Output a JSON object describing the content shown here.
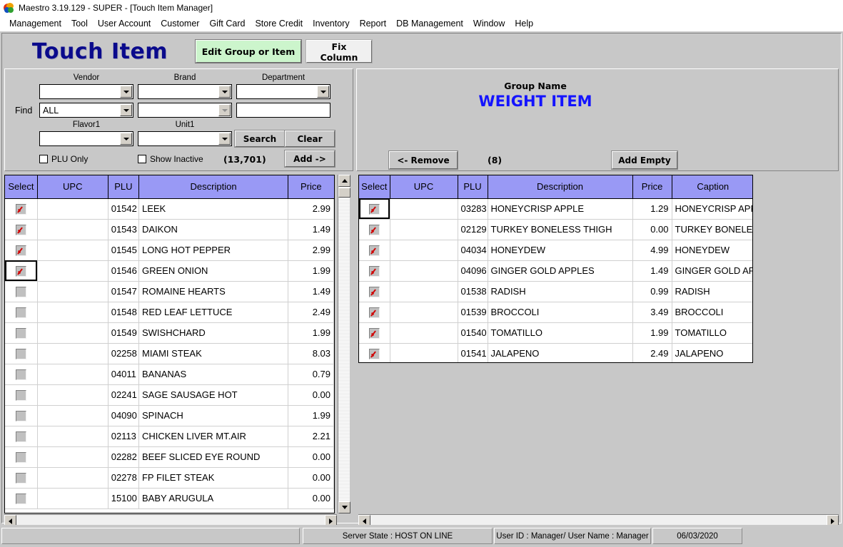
{
  "window": {
    "title": "Maestro  3.19.129 - SUPER - [Touch Item Manager]",
    "icon": "maestro-app-icon"
  },
  "menubar": {
    "items": [
      {
        "label": "Management"
      },
      {
        "label": "Tool"
      },
      {
        "label": "User Account"
      },
      {
        "label": "Customer"
      },
      {
        "label": "Gift Card"
      },
      {
        "label": "Store Credit"
      },
      {
        "label": "Inventory"
      },
      {
        "label": "Report"
      },
      {
        "label": "DB Management"
      },
      {
        "label": "Window"
      },
      {
        "label": "Help"
      }
    ]
  },
  "header": {
    "title": "Touch Item",
    "edit_group_button": "Edit Group or Item",
    "fix_column_button": "Fix Column",
    "title_color": "#0a0a8c",
    "edit_group_bg": "#ccf5cc"
  },
  "search": {
    "find_label": "Find",
    "vendor_label": "Vendor",
    "brand_label": "Brand",
    "department_label": "Department",
    "flavor_label": "Flavor1",
    "unit_label": "Unit1",
    "vendor_value": "",
    "brand_value": "",
    "department_value": "",
    "find_vendor_value": "ALL",
    "find_brand_value": "",
    "find_department_value": "",
    "flavor_value": "",
    "unit_value": "",
    "search_button": "Search",
    "clear_button": "Clear",
    "add_button": "Add ->",
    "plu_only_label": "PLU Only",
    "show_inactive_label": "Show Inactive",
    "plu_only_checked": false,
    "show_inactive_checked": false,
    "result_count": "(13,701)"
  },
  "group": {
    "name_label": "Group Name",
    "name_value": "WEIGHT ITEM",
    "name_color": "#1414ff",
    "remove_button": "<- Remove",
    "add_empty_button": "Add Empty",
    "item_count": "(8)"
  },
  "left_grid": {
    "columns": [
      "Select",
      "UPC",
      "PLU",
      "Description",
      "Price"
    ],
    "focused_row": 3,
    "rows": [
      {
        "checked": true,
        "upc": "",
        "plu": "01542",
        "description": "LEEK",
        "price": "2.99"
      },
      {
        "checked": true,
        "upc": "",
        "plu": "01543",
        "description": "DAIKON",
        "price": "1.49"
      },
      {
        "checked": true,
        "upc": "",
        "plu": "01545",
        "description": "LONG HOT PEPPER",
        "price": "2.99"
      },
      {
        "checked": true,
        "upc": "",
        "plu": "01546",
        "description": "GREEN ONION",
        "price": "1.99"
      },
      {
        "checked": false,
        "upc": "",
        "plu": "01547",
        "description": "ROMAINE HEARTS",
        "price": "1.49"
      },
      {
        "checked": false,
        "upc": "",
        "plu": "01548",
        "description": "RED LEAF LETTUCE",
        "price": "2.49"
      },
      {
        "checked": false,
        "upc": "",
        "plu": "01549",
        "description": "SWISHCHARD",
        "price": "1.99"
      },
      {
        "checked": false,
        "upc": "",
        "plu": "02258",
        "description": "MIAMI STEAK",
        "price": "8.03"
      },
      {
        "checked": false,
        "upc": "",
        "plu": "04011",
        "description": "BANANAS",
        "price": "0.79"
      },
      {
        "checked": false,
        "upc": "",
        "plu": "02241",
        "description": "SAGE SAUSAGE HOT",
        "price": "0.00"
      },
      {
        "checked": false,
        "upc": "",
        "plu": "04090",
        "description": "SPINACH",
        "price": "1.99"
      },
      {
        "checked": false,
        "upc": "",
        "plu": "02113",
        "description": "CHICKEN LIVER MT.AIR",
        "price": "2.21"
      },
      {
        "checked": false,
        "upc": "",
        "plu": "02282",
        "description": "BEEF SLICED EYE ROUND",
        "price": "0.00"
      },
      {
        "checked": false,
        "upc": "",
        "plu": "02278",
        "description": "FP FILET STEAK",
        "price": "0.00"
      },
      {
        "checked": false,
        "upc": "",
        "plu": "15100",
        "description": "BABY ARUGULA",
        "price": "0.00"
      }
    ]
  },
  "right_grid": {
    "columns": [
      "Select",
      "UPC",
      "PLU",
      "Description",
      "Price",
      "Caption"
    ],
    "focused_row": 0,
    "rows": [
      {
        "checked": true,
        "upc": "",
        "plu": "03283",
        "description": "HONEYCRISP APPLE",
        "price": "1.29",
        "caption": "HONEYCRISP APPLE"
      },
      {
        "checked": true,
        "upc": "",
        "plu": "02129",
        "description": "TURKEY BONELESS THIGH",
        "price": "0.00",
        "caption": "TURKEY BONELESS THIGH"
      },
      {
        "checked": true,
        "upc": "",
        "plu": "04034",
        "description": "HONEYDEW",
        "price": "4.99",
        "caption": "HONEYDEW"
      },
      {
        "checked": true,
        "upc": "",
        "plu": "04096",
        "description": "GINGER GOLD APPLES",
        "price": "1.49",
        "caption": "GINGER GOLD APPLES"
      },
      {
        "checked": true,
        "upc": "",
        "plu": "01538",
        "description": "RADISH",
        "price": "0.99",
        "caption": "RADISH"
      },
      {
        "checked": true,
        "upc": "",
        "plu": "01539",
        "description": "BROCCOLI",
        "price": "3.49",
        "caption": "BROCCOLI"
      },
      {
        "checked": true,
        "upc": "",
        "plu": "01540",
        "description": "TOMATILLO",
        "price": "1.99",
        "caption": "TOMATILLO"
      },
      {
        "checked": true,
        "upc": "",
        "plu": "01541",
        "description": "JALAPENO",
        "price": "2.49",
        "caption": "JALAPENO"
      }
    ]
  },
  "statusbar": {
    "server_state": "Server State : HOST ON LINE",
    "user_info": "User ID : Manager/ User Name : Manager",
    "date": "06/03/2020"
  }
}
